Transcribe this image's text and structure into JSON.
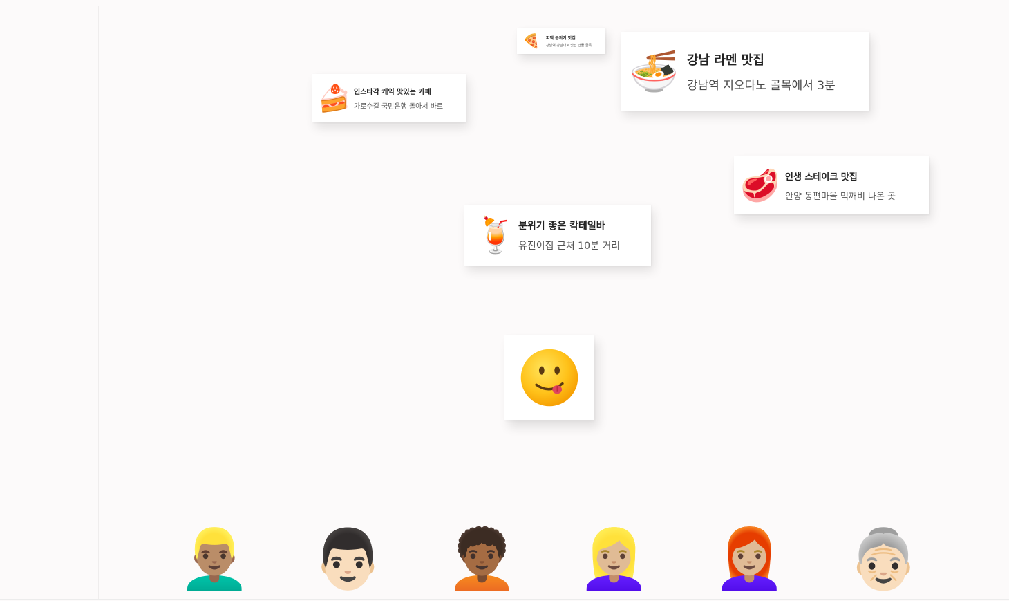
{
  "cards": [
    {
      "id": "pizza",
      "icon": "🍕",
      "icon_name": "pizza-icon",
      "title": "피맥 분위기 맛집",
      "subtitle": "강남역 강남대로 맛집 건물 골목"
    },
    {
      "id": "ramen",
      "icon": "🍜",
      "icon_name": "ramen-bowl-icon",
      "title": "강남 라멘 맛집",
      "subtitle": "강남역 지오다노 골목에서 3분"
    },
    {
      "id": "cake",
      "icon": "🍰",
      "icon_name": "cake-icon",
      "title": "인스타각 케익 맛있는 카페",
      "subtitle": "가로수길 국민은행 돌아서 바로"
    },
    {
      "id": "steak",
      "icon": "🥩",
      "icon_name": "steak-icon",
      "title": "인생 스테이크 맛집",
      "subtitle": "안양 동편마을 먹깨비 나온 곳"
    },
    {
      "id": "cocktail",
      "icon": "🍹",
      "icon_name": "cocktail-icon",
      "title": "분위기 좋은 칵테일바",
      "subtitle": "유진이집 근처 10분 거리"
    }
  ],
  "center_face": {
    "icon_name": "yum-face-icon"
  },
  "people": [
    {
      "icon": "👱🏽‍♂️",
      "icon_name": "blond-man-avatar-icon"
    },
    {
      "icon": "👨🏻",
      "icon_name": "man-mustache-avatar-icon"
    },
    {
      "icon": "🧑🏾‍🦱",
      "icon_name": "curly-hair-person-avatar-icon"
    },
    {
      "icon": "👱🏼‍♀️",
      "icon_name": "blond-woman-avatar-icon"
    },
    {
      "icon": "👩🏼‍🦰",
      "icon_name": "red-hair-woman-avatar-icon"
    },
    {
      "icon": "👵🏻",
      "icon_name": "grandmother-avatar-icon"
    }
  ],
  "colors": {
    "background": "#fcfafa",
    "card": "#ffffff",
    "title_text": "#222222",
    "subtitle_text": "#555555"
  }
}
